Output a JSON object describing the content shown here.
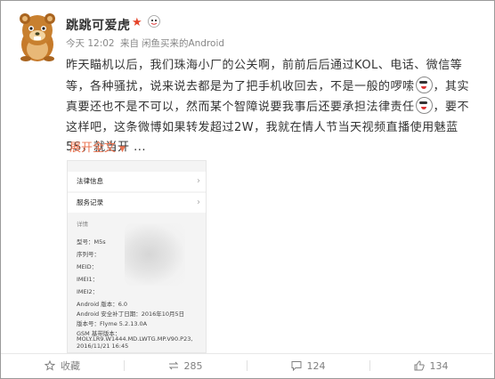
{
  "user": {
    "name": "跳跳可爱虎",
    "badge": "★"
  },
  "meta": {
    "time": "今天 12:02",
    "via": "来自",
    "source": "闲鱼买来的Android"
  },
  "post": {
    "p1": "昨天瞄机以后，我们珠海小厂的公关啊，前前后后通过KOL、电话、微信等等，各种骚扰，说来说去都是为了把手机收回去，不是一般的啰嗦",
    "p2": "，其实真要还也不是不可以，然而某个智障说要我事后还要承担法律责任",
    "p3": "，要不这样吧，这条微博如果转发超过2W，我就在情人节当天视频直播使用魅蓝5S，就当开 ...",
    "expand": "展开全文",
    "expand_caret": "▼"
  },
  "screenshot": {
    "row1": "法律信息",
    "row2": "服务记录",
    "section": "详情",
    "model": "型号：M5s",
    "serial": "序列号：",
    "meid": "MEID：",
    "imei1": "IMEI1：",
    "imei2": "IMEI2：",
    "android": "Android 版本：6.0",
    "patch": "Android 安全补丁日期：2016年10月5日",
    "version": "版本号：Flyme 5.2.13.0A",
    "gsm_label": "GSM 基带版本：",
    "gsm_value": "MOLY.LR9.W1444.MD.LWTG.MP.V90.P23,",
    "gsm_date": "2016/11/21 16:45"
  },
  "actions": {
    "favorite": "收藏",
    "repost": "285",
    "comment": "124",
    "like": "134"
  },
  "colors": {
    "accent": "#eb7350",
    "badge": "#e5442a",
    "text": "#333333",
    "meta": "#888888"
  }
}
